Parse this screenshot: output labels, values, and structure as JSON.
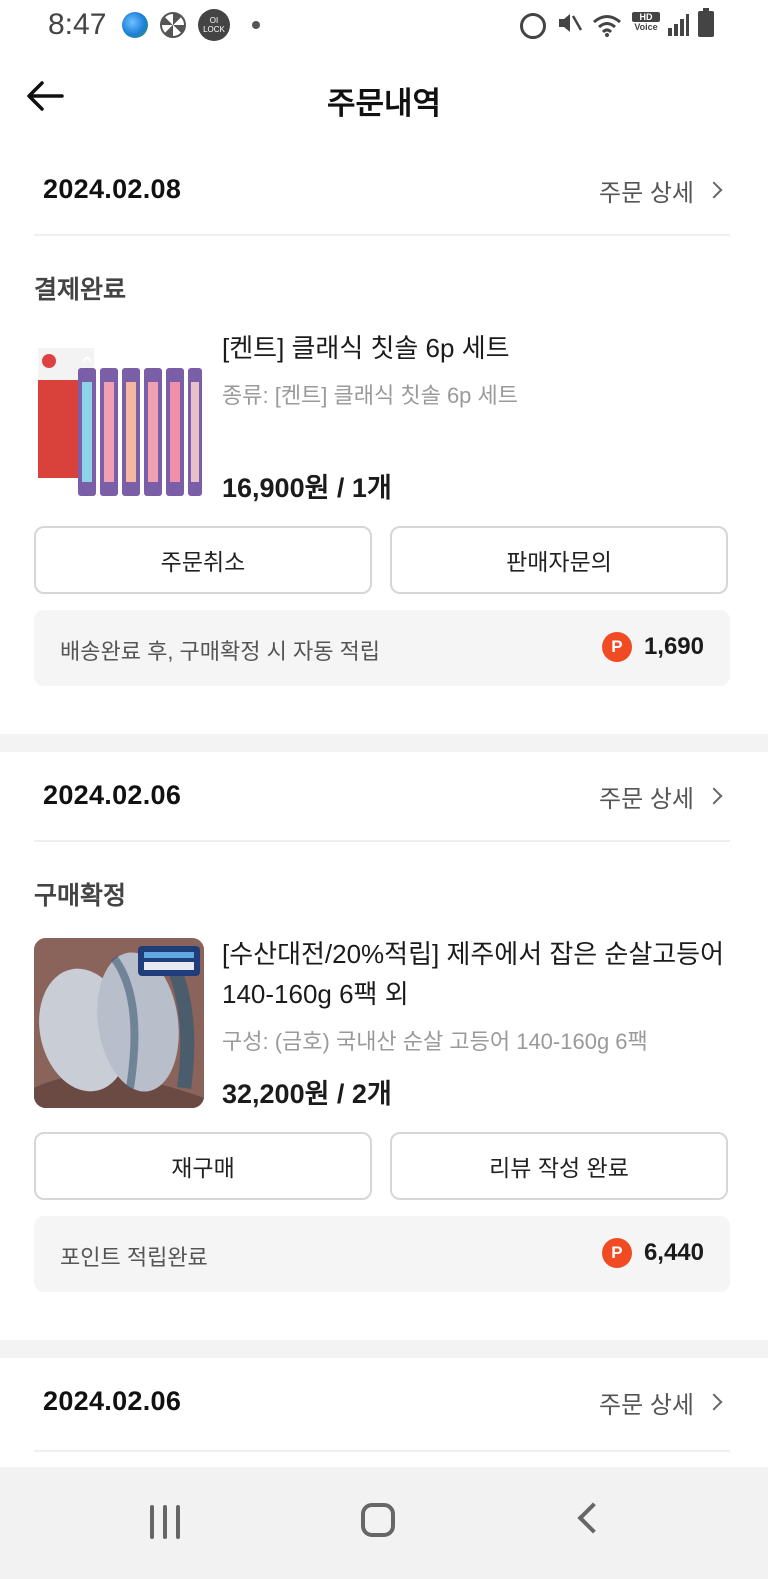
{
  "status_bar": {
    "time": "8:47",
    "left_icons": [
      "globe-icon",
      "fan-icon",
      "oilock-icon",
      "dot-icon"
    ],
    "oilock_text": "OI\nLOCK",
    "hd_voice": {
      "top": "HD",
      "bottom": "Voice"
    },
    "right_icons": [
      "alarm-icon",
      "mute-icon",
      "wifi-icon",
      "hd-voice-icon",
      "signal-icon",
      "battery-icon"
    ]
  },
  "header": {
    "back_icon": "arrow-left-icon",
    "title": "주문내역"
  },
  "orders": [
    {
      "date": "2024.02.08",
      "detail_label": "주문 상세",
      "status": "결제완료",
      "product": {
        "name": "[켄트] 클래식 칫솔 6p 세트",
        "option": "종류: [켄트] 클래식 칫솔 6p 세트",
        "price": "16,900원 / 1개",
        "image": "toothbrush-set-image"
      },
      "buttons": [
        "주문취소",
        "판매자문의"
      ],
      "point": {
        "text": "배송완료 후, 구매확정 시 자동 적립",
        "badge": "P",
        "amount": "1,690"
      }
    },
    {
      "date": "2024.02.06",
      "detail_label": "주문 상세",
      "status": "구매확정",
      "product": {
        "name": "[수산대전/20%적립] 제주에서 잡은 순살고등어 140-160g 6팩 외",
        "option": "구성: (금호) 국내산 순살 고등어 140-160g 6팩",
        "price": "32,200원 / 2개",
        "image": "mackerel-image"
      },
      "buttons": [
        "재구매",
        "리뷰 작성 완료"
      ],
      "point": {
        "text": "포인트 적립완료",
        "badge": "P",
        "amount": "6,440"
      }
    },
    {
      "date": "2024.02.06",
      "detail_label": "주문 상세"
    }
  ],
  "nav_bar": {
    "buttons": [
      "recent-apps-icon",
      "home-icon",
      "back-icon"
    ]
  },
  "colors": {
    "point_badge": "#f04b23",
    "divider": "#f3f3f3",
    "point_box_bg": "#f5f5f5",
    "nav_bg": "#f2f2f2"
  }
}
